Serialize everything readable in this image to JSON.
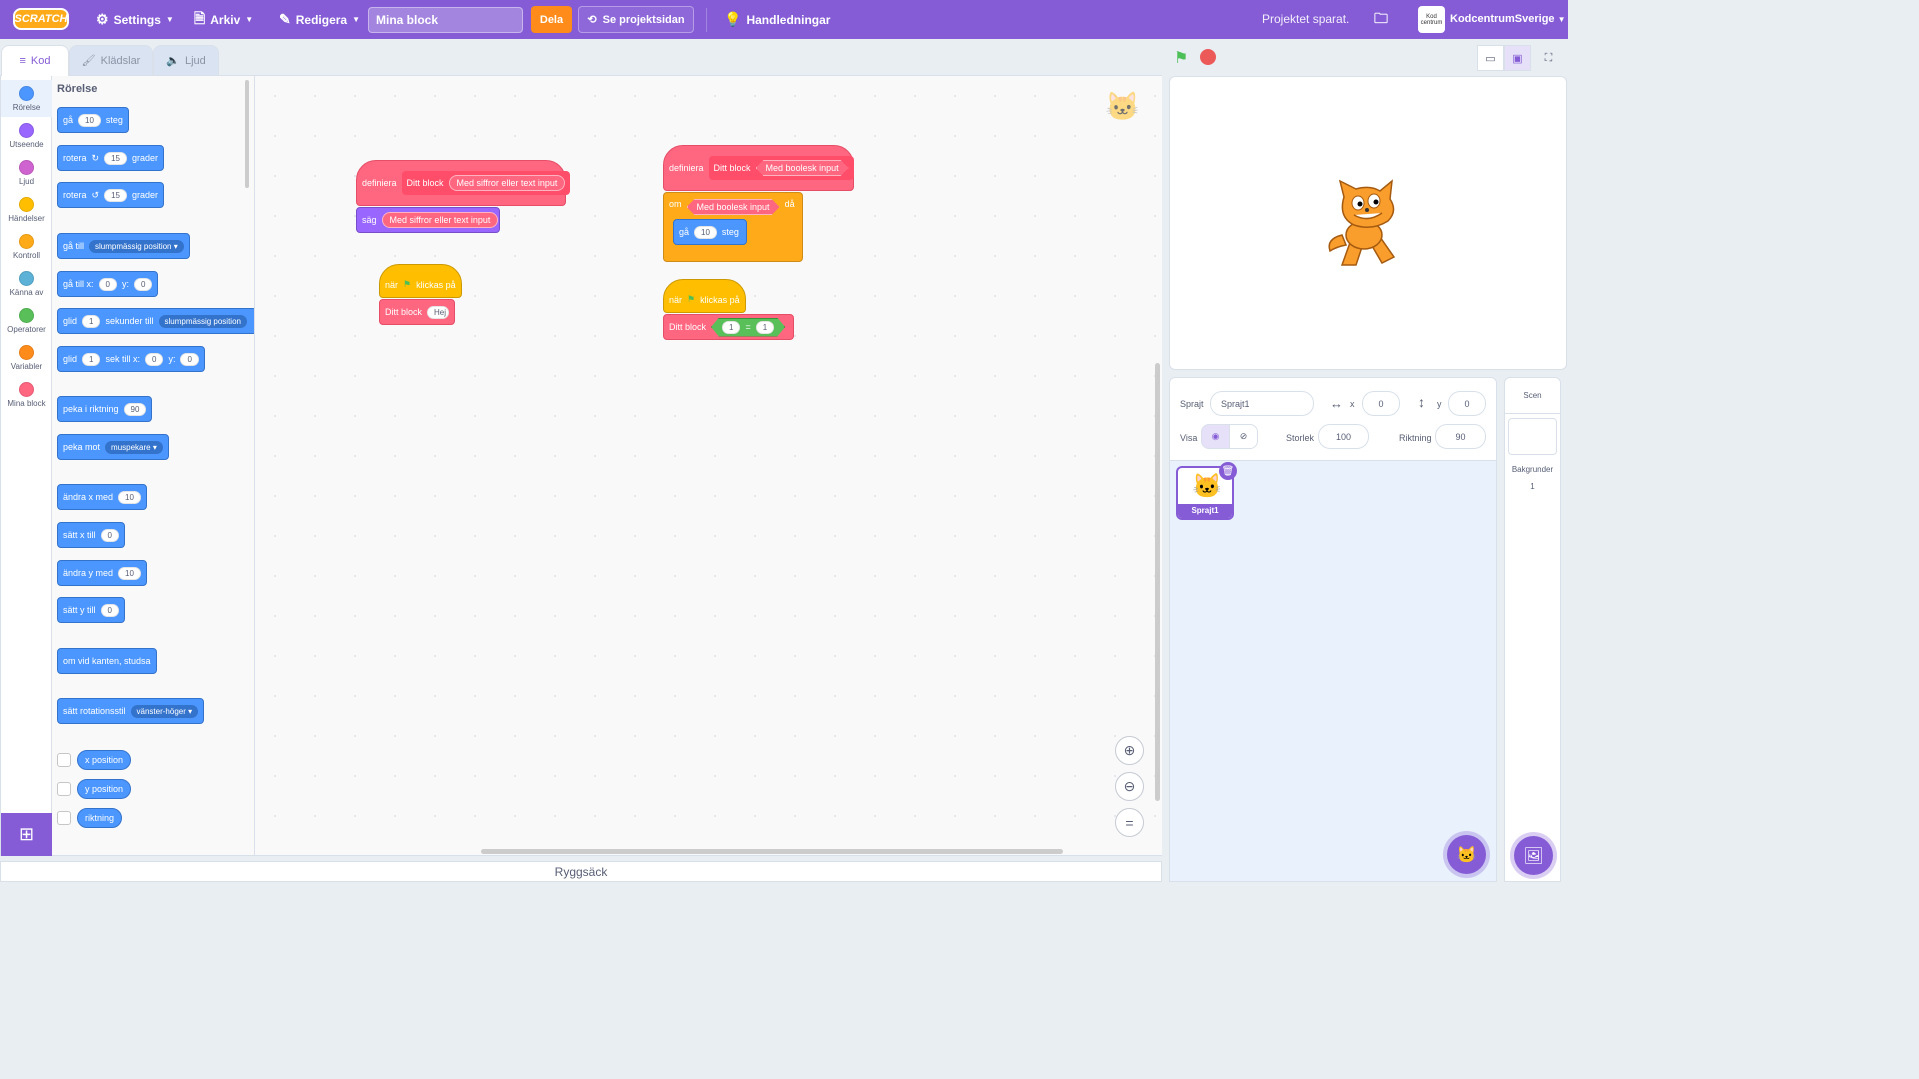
{
  "menubar": {
    "logo": "SCRATCH",
    "settings": "Settings",
    "file": "Arkiv",
    "edit": "Redigera",
    "project_title": "Mina block",
    "share": "Dela",
    "see_project": "Se projektsidan",
    "tutorials": "Handledningar",
    "saved_status": "Projektet sparat.",
    "avatar_text": "Kod centrum",
    "username": "KodcentrumSverige"
  },
  "tabs": {
    "code": "Kod",
    "costumes": "Klädslar",
    "sounds": "Ljud"
  },
  "categories": [
    {
      "label": "Rörelse",
      "color": "#4c97ff"
    },
    {
      "label": "Utseende",
      "color": "#9966ff"
    },
    {
      "label": "Ljud",
      "color": "#cf63cf"
    },
    {
      "label": "Händelser",
      "color": "#ffbf00"
    },
    {
      "label": "Kontroll",
      "color": "#ffab19"
    },
    {
      "label": "Känna av",
      "color": "#5cb1d6"
    },
    {
      "label": "Operatorer",
      "color": "#59c059"
    },
    {
      "label": "Variabler",
      "color": "#ff8c1a"
    },
    {
      "label": "Mina block",
      "color": "#ff6680"
    }
  ],
  "palette": {
    "heading": "Rörelse",
    "move": {
      "a": "gå",
      "n": "10",
      "b": "steg"
    },
    "turn_right": {
      "a": "rotera",
      "n": "15",
      "b": "grader"
    },
    "turn_left": {
      "a": "rotera",
      "n": "15",
      "b": "grader"
    },
    "goto": {
      "a": "gå till",
      "d": "slumpmässig position"
    },
    "goto_xy": {
      "a": "gå till x:",
      "x": "0",
      "b": "y:",
      "y": "0"
    },
    "glide_to": {
      "a": "glid",
      "n": "1",
      "b": "sekunder till",
      "d": "slumpmässig position"
    },
    "glide_xy": {
      "a": "glid",
      "n": "1",
      "b": "sek till x:",
      "x": "0",
      "c": "y:",
      "y": "0"
    },
    "point_dir": {
      "a": "peka i riktning",
      "n": "90"
    },
    "point_towards": {
      "a": "peka mot",
      "d": "muspekare"
    },
    "change_x": {
      "a": "ändra x med",
      "n": "10"
    },
    "set_x": {
      "a": "sätt x till",
      "n": "0"
    },
    "change_y": {
      "a": "ändra y med",
      "n": "10"
    },
    "set_y": {
      "a": "sätt y till",
      "n": "0"
    },
    "bounce": "om vid kanten, studsa",
    "rotation_style": {
      "a": "sätt rotationsstil",
      "d": "vänster-höger"
    },
    "reporters": [
      "x position",
      "y position",
      "riktning"
    ]
  },
  "workspace": {
    "def1": {
      "define": "definiera",
      "name": "Ditt block",
      "arg": "Med siffror eller text input"
    },
    "say": {
      "a": "säg",
      "arg": "Med siffror eller text input"
    },
    "hat1": {
      "a": "när",
      "b": "klickas på"
    },
    "call1": {
      "a": "Ditt block",
      "arg": "Hej"
    },
    "def2": {
      "define": "definiera",
      "name": "Ditt block",
      "arg": "Med boolesk input"
    },
    "if": {
      "a": "om",
      "arg": "Med boolesk input",
      "b": "då"
    },
    "move": {
      "a": "gå",
      "n": "10",
      "b": "steg"
    },
    "hat2": {
      "a": "när",
      "b": "klickas på"
    },
    "call2": {
      "a": "Ditt block",
      "l": "1",
      "op": "=",
      "r": "1"
    }
  },
  "backpack": "Ryggsäck",
  "sprite_info": {
    "sprite_label": "Sprajt",
    "sprite_name": "Sprajt1",
    "x_label": "x",
    "x_value": "0",
    "y_label": "y",
    "y_value": "0",
    "show_label": "Visa",
    "size_label": "Storlek",
    "size_value": "100",
    "direction_label": "Riktning",
    "direction_value": "90"
  },
  "sprites": [
    {
      "name": "Sprajt1"
    }
  ],
  "scene": {
    "title": "Scen",
    "backdrops_label": "Bakgrunder",
    "backdrops_count": "1"
  }
}
